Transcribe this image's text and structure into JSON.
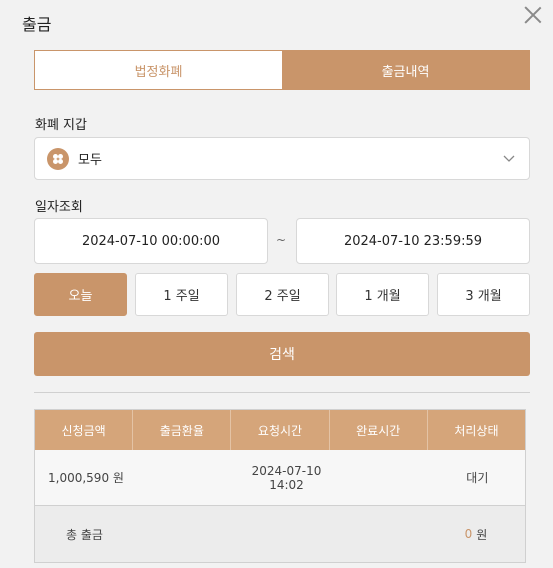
{
  "modal": {
    "title": "출금"
  },
  "tabs": [
    {
      "label": "법정화폐",
      "active": false
    },
    {
      "label": "출금내역",
      "active": true
    }
  ],
  "wallet": {
    "label": "화폐 지갑",
    "selected": "모두",
    "icon": "coin-icon"
  },
  "date": {
    "label": "일자조회",
    "from": "2024-07-10 00:00:00",
    "separator": "~",
    "to": "2024-07-10 23:59:59"
  },
  "periods": [
    {
      "label": "오늘",
      "active": true
    },
    {
      "label": "1 주일",
      "active": false
    },
    {
      "label": "2 주일",
      "active": false
    },
    {
      "label": "1 개월",
      "active": false
    },
    {
      "label": "3 개월",
      "active": false
    }
  ],
  "search": {
    "label": "검색"
  },
  "table": {
    "columns": [
      "신청금액",
      "출금환율",
      "요청시간",
      "완료시간",
      "처리상태"
    ],
    "rows": [
      {
        "amount": "1,000,590 원",
        "rate": "",
        "request_date": "2024-07-10",
        "request_time": "14:02",
        "complete": "",
        "status": "대기"
      }
    ],
    "total": {
      "label": "총 출금",
      "value": "0",
      "unit": "원"
    }
  },
  "colors": {
    "accent": "#c9956a",
    "header": "#d5a57a"
  }
}
